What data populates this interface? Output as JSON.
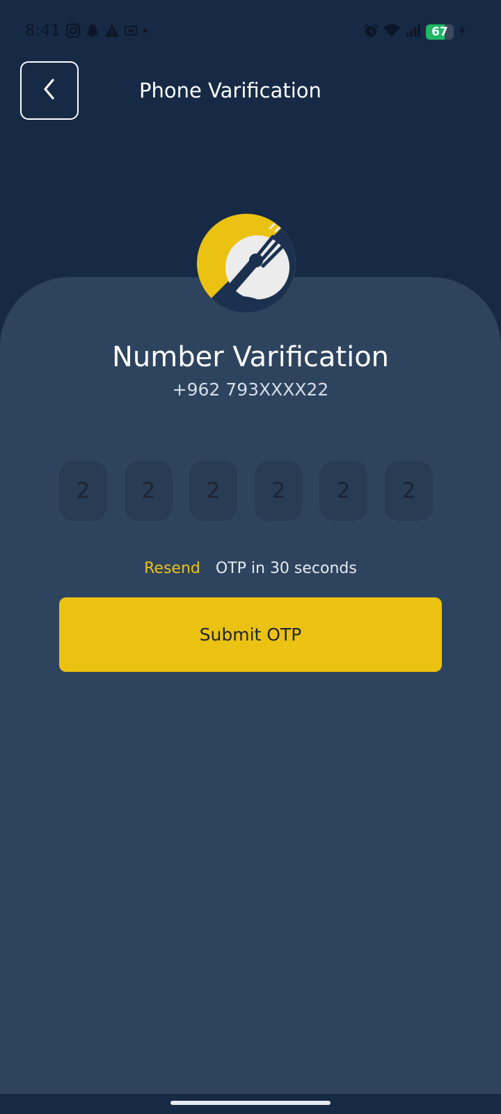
{
  "status_bar": {
    "time": "8:41",
    "battery_level": "67",
    "battery_fraction": 0.67,
    "left_icons": [
      "instagram-icon",
      "snapchat-icon",
      "warning-icon",
      "vpn-icon",
      "dot-icon"
    ],
    "right_icons": [
      "alarm-icon",
      "wifi-icon",
      "signal-icon",
      "battery-icon",
      "charging-icon"
    ]
  },
  "header": {
    "title": "Phone Varification",
    "back_icon": "chevron-left-icon"
  },
  "verification": {
    "title": "Number Varification",
    "phone_number": "+962 793XXXX22"
  },
  "otp": {
    "digits": [
      "2",
      "2",
      "2",
      "2",
      "2",
      "2"
    ]
  },
  "resend": {
    "link_label": "Resend",
    "countdown_text": "OTP in 30 seconds"
  },
  "submit": {
    "label": "Submit OTP"
  },
  "colors": {
    "background": "#172a45",
    "card": "#2e445e",
    "accent": "#ecc212",
    "otp_box": "#283c54",
    "battery_green": "#1fb866"
  }
}
